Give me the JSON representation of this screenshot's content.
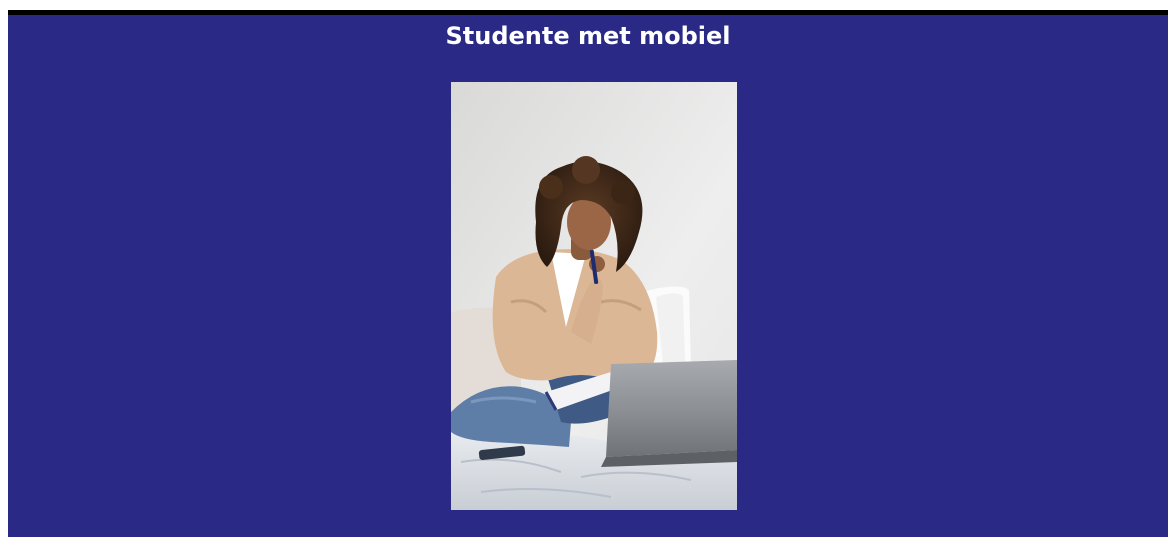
{
  "page": {
    "title": "Studente met mobiel"
  },
  "image": {
    "subject": "student-photo",
    "colors": {
      "background": "#2a2a86",
      "top_border": "#000000",
      "title_text": "#ffffff"
    }
  }
}
